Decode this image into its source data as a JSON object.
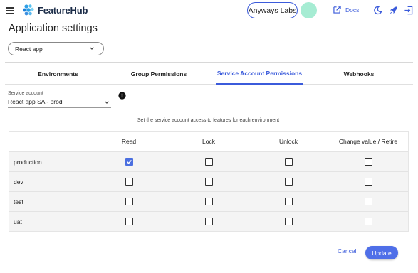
{
  "header": {
    "brand": "FeatureHub",
    "organization": "Anyways Labs",
    "avatar_initial": "",
    "docs_label": "Docs",
    "icons": [
      "menu-icon",
      "featurehub-logo",
      "external-link-icon",
      "dark-mode-icon",
      "rocket-icon",
      "logout-icon"
    ]
  },
  "page": {
    "title": "Application settings",
    "app_selected": "React app"
  },
  "tabs": [
    {
      "label": "Environments",
      "active": false
    },
    {
      "label": "Group Permissions",
      "active": false
    },
    {
      "label": "Service Account Permissions",
      "active": true
    },
    {
      "label": "Webhooks",
      "active": false
    }
  ],
  "service_account": {
    "label": "Service account",
    "selected": "React app SA - prod"
  },
  "hint": "Set the service account access to features for each environment",
  "permissions": {
    "columns": [
      "Read",
      "Lock",
      "Unlock",
      "Change value / Retire"
    ],
    "rows": [
      {
        "env": "production",
        "values": [
          true,
          false,
          false,
          false
        ]
      },
      {
        "env": "dev",
        "values": [
          false,
          false,
          false,
          false
        ]
      },
      {
        "env": "test",
        "values": [
          false,
          false,
          false,
          false
        ]
      },
      {
        "env": "uat",
        "values": [
          false,
          false,
          false,
          false
        ]
      }
    ]
  },
  "actions": {
    "cancel": "Cancel",
    "update": "Update"
  },
  "colors": {
    "accent": "#3b5bdb",
    "button": "#4f6fe8",
    "avatar": "#a6ecd3",
    "row_background": "#f4f4f4"
  }
}
